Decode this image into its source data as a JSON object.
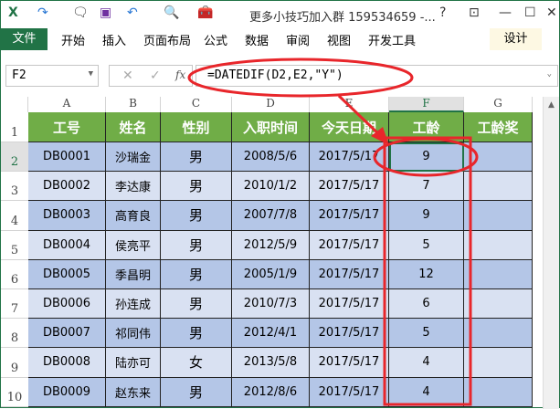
{
  "titlebar": {
    "title": "更多小技巧加入群 159534659 -...",
    "help": "?",
    "min": "—",
    "max": "☐",
    "close": "✕"
  },
  "menu": {
    "file": "文件",
    "items": [
      "开始",
      "插入",
      "页面布局",
      "公式",
      "数据",
      "审阅",
      "视图",
      "开发工具"
    ],
    "design": "设计"
  },
  "formula_bar": {
    "name_box": "F2",
    "formula": "=DATEDIF(D2,E2,\"Y\")",
    "fx": "fx",
    "cancel": "✕",
    "enter": "✓"
  },
  "columns": [
    "A",
    "B",
    "C",
    "D",
    "E",
    "F",
    "G"
  ],
  "row_numbers": [
    "1",
    "2",
    "3",
    "4",
    "5",
    "6",
    "7",
    "8",
    "9",
    "10"
  ],
  "headers": [
    "工号",
    "姓名",
    "性别",
    "入职时间",
    "今天日期",
    "工龄",
    "工龄奖"
  ],
  "rows": [
    [
      "DB0001",
      "沙瑞金",
      "男",
      "2008/5/6",
      "2017/5/17",
      "9",
      ""
    ],
    [
      "DB0002",
      "李达康",
      "男",
      "2010/1/2",
      "2017/5/17",
      "7",
      ""
    ],
    [
      "DB0003",
      "高育良",
      "男",
      "2007/7/8",
      "2017/5/17",
      "9",
      ""
    ],
    [
      "DB0004",
      "侯亮平",
      "男",
      "2012/5/9",
      "2017/5/17",
      "5",
      ""
    ],
    [
      "DB0005",
      "季昌明",
      "男",
      "2005/1/9",
      "2017/5/17",
      "12",
      ""
    ],
    [
      "DB0006",
      "孙连成",
      "男",
      "2010/7/3",
      "2017/5/17",
      "6",
      ""
    ],
    [
      "DB0007",
      "祁同伟",
      "男",
      "2012/4/1",
      "2017/5/17",
      "5",
      ""
    ],
    [
      "DB0008",
      "陆亦可",
      "女",
      "2013/5/8",
      "2017/5/17",
      "4",
      ""
    ],
    [
      "DB0009",
      "赵东来",
      "男",
      "2012/8/6",
      "2017/5/17",
      "4",
      ""
    ]
  ],
  "colors": {
    "header": "#70ad47",
    "row_dark": "#b4c6e7",
    "row_light": "#d9e1f2",
    "annotation": "#e8262b"
  }
}
